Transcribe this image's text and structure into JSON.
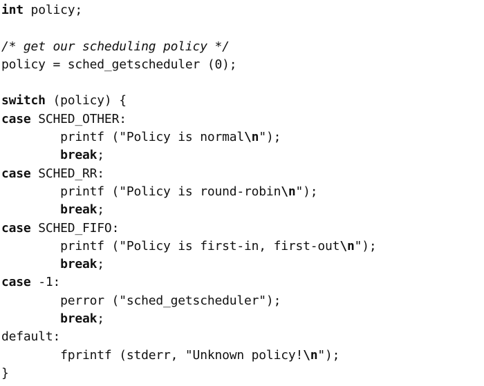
{
  "code_lines": [
    [
      {
        "t": "int",
        "s": "kw"
      },
      {
        "t": " policy;",
        "s": ""
      }
    ],
    [],
    [
      {
        "t": "/* get our scheduling policy */",
        "s": "cm"
      }
    ],
    [
      {
        "t": "policy = sched_getscheduler (0);",
        "s": ""
      }
    ],
    [],
    [
      {
        "t": "switch",
        "s": "kw"
      },
      {
        "t": " (policy) {",
        "s": ""
      }
    ],
    [
      {
        "t": "case",
        "s": "kw"
      },
      {
        "t": " SCHED_OTHER:",
        "s": ""
      }
    ],
    [
      {
        "t": "        printf (\"Policy is normal",
        "s": ""
      },
      {
        "t": "\\n",
        "s": "esc"
      },
      {
        "t": "\");",
        "s": ""
      }
    ],
    [
      {
        "t": "        ",
        "s": ""
      },
      {
        "t": "break",
        "s": "kw"
      },
      {
        "t": ";",
        "s": ""
      }
    ],
    [
      {
        "t": "case",
        "s": "kw"
      },
      {
        "t": " SCHED_RR:",
        "s": ""
      }
    ],
    [
      {
        "t": "        printf (\"Policy is round-robin",
        "s": ""
      },
      {
        "t": "\\n",
        "s": "esc"
      },
      {
        "t": "\");",
        "s": ""
      }
    ],
    [
      {
        "t": "        ",
        "s": ""
      },
      {
        "t": "break",
        "s": "kw"
      },
      {
        "t": ";",
        "s": ""
      }
    ],
    [
      {
        "t": "case",
        "s": "kw"
      },
      {
        "t": " SCHED_FIFO:",
        "s": ""
      }
    ],
    [
      {
        "t": "        printf (\"Policy is first-in, first-out",
        "s": ""
      },
      {
        "t": "\\n",
        "s": "esc"
      },
      {
        "t": "\");",
        "s": ""
      }
    ],
    [
      {
        "t": "        ",
        "s": ""
      },
      {
        "t": "break",
        "s": "kw"
      },
      {
        "t": ";",
        "s": ""
      }
    ],
    [
      {
        "t": "case",
        "s": "kw"
      },
      {
        "t": " -1:",
        "s": ""
      }
    ],
    [
      {
        "t": "        perror (\"sched_getscheduler\");",
        "s": ""
      }
    ],
    [
      {
        "t": "        ",
        "s": ""
      },
      {
        "t": "break",
        "s": "kw"
      },
      {
        "t": ";",
        "s": ""
      }
    ],
    [
      {
        "t": "default:",
        "s": ""
      }
    ],
    [
      {
        "t": "        fprintf (stderr, \"Unknown policy!",
        "s": ""
      },
      {
        "t": "\\n",
        "s": "esc"
      },
      {
        "t": "\");",
        "s": ""
      }
    ],
    [
      {
        "t": "}",
        "s": ""
      }
    ]
  ]
}
